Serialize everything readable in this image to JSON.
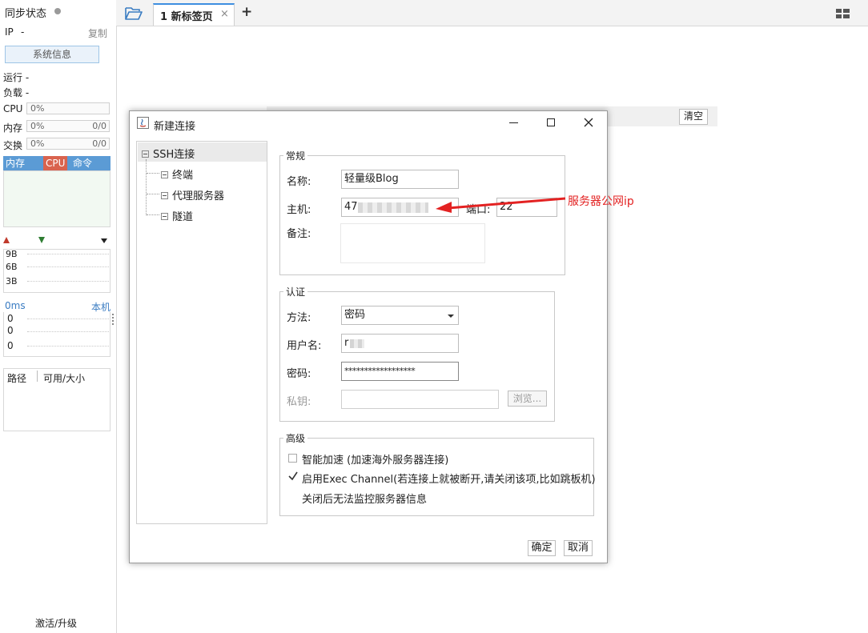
{
  "sidebar": {
    "sync_status": "同步状态",
    "ip_label": "IP",
    "ip_value": "-",
    "copy": "复制",
    "sys_info_btn": "系统信息",
    "uptime": "运行 -",
    "load": "负载 -",
    "cpu_label": "CPU",
    "cpu_value": "0%",
    "mem_label": "内存",
    "mem_value": "0%",
    "mem_size": "0/0",
    "swap_label": "交换",
    "swap_value": "0%",
    "swap_size": "0/0",
    "proc_tabs": [
      "内存",
      "CPU",
      "命令"
    ],
    "net_labels": [
      "9B",
      "6B",
      "3B"
    ],
    "latency": "0ms",
    "local": "本机",
    "ping_labels": [
      "0",
      "0",
      "0"
    ],
    "disk_col_path": "路径",
    "disk_col_usage": "可用/大小",
    "activate": "激活/升级",
    "colors": {
      "cpu_tab": "#d9634e",
      "tab_blue": "#5b9bd5"
    }
  },
  "topbar": {
    "tab_label": "1 新标签页",
    "close": "×",
    "add": "+"
  },
  "background": {
    "clear_btn": "清空"
  },
  "dialog": {
    "title": "新建连接",
    "tree": {
      "root": "SSH连接",
      "children": [
        "终端",
        "代理服务器",
        "隧道"
      ]
    },
    "general": {
      "legend": "常规",
      "name_label": "名称:",
      "name_value": "轻量级Blog",
      "host_label": "主机:",
      "host_value": "47",
      "port_label": "端口:",
      "port_value": "22",
      "note_label": "备注:"
    },
    "auth": {
      "legend": "认证",
      "method_label": "方法:",
      "method_value": "密码",
      "user_label": "用户名:",
      "user_value": "r",
      "pass_label": "密码:",
      "pass_value": "******************",
      "key_label": "私钥:",
      "browse": "浏览..."
    },
    "advanced": {
      "legend": "高级",
      "smart_accel": "智能加速 (加速海外服务器连接)",
      "smart_accel_checked": false,
      "exec_channel": "启用Exec Channel(若连接上就被断开,请关闭该项,比如跳板机)",
      "exec_channel_checked": true,
      "exec_note": "关闭后无法监控服务器信息"
    },
    "ok": "确定",
    "cancel": "取消"
  },
  "annotation": {
    "text": "服务器公网ip",
    "color": "#e32222"
  }
}
